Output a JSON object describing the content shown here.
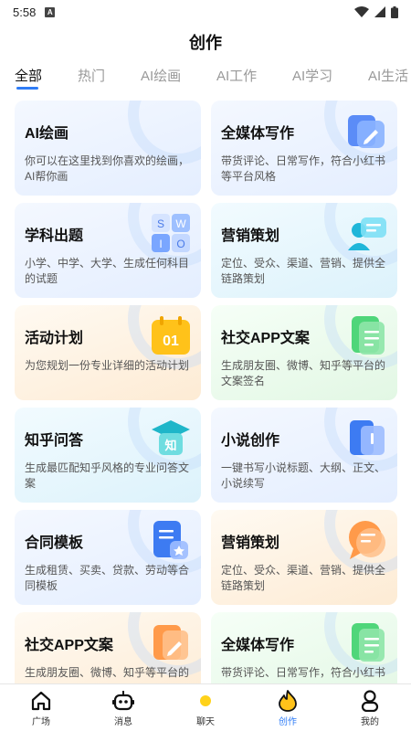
{
  "status_bar": {
    "time": "5:58",
    "app_icon": "A"
  },
  "header": {
    "title": "创作"
  },
  "tabs": [
    {
      "label": "全部",
      "active": true
    },
    {
      "label": "热门"
    },
    {
      "label": "AI绘画"
    },
    {
      "label": "AI工作"
    },
    {
      "label": "AI学习"
    },
    {
      "label": "AI生活"
    }
  ],
  "cards": [
    {
      "title": "AI绘画",
      "desc": "你可以在这里找到你喜欢的绘画，AI帮你画",
      "icon": "none"
    },
    {
      "title": "全媒体写作",
      "desc": "带货评论、日常写作，符合小红书等平台风格",
      "icon": "pencil-doc-icon"
    },
    {
      "title": "学科出题",
      "desc": "小学、中学、大学、生成任何科目的试题",
      "icon": "swio-blocks-icon",
      "icon_letters": [
        "S",
        "W",
        "I",
        "O"
      ]
    },
    {
      "title": "营销策划",
      "desc": "定位、受众、渠道、营销、提供全链路策划",
      "icon": "person-chat-icon"
    },
    {
      "title": "活动计划",
      "desc": "为您规划一份专业详细的活动计划",
      "icon": "calendar-icon",
      "icon_text": "01"
    },
    {
      "title": "社交APP文案",
      "desc": "生成朋友圈、微博、知乎等平台的文案签名",
      "icon": "green-doc-icon"
    },
    {
      "title": "知乎问答",
      "desc": "生成最匹配知乎风格的专业问答文案",
      "icon": "graduation-cap-icon",
      "icon_text": "知"
    },
    {
      "title": "小说创作",
      "desc": "一键书写小说标题、大纲、正文、小说续写",
      "icon": "book-icon"
    },
    {
      "title": "合同模板",
      "desc": "生成租赁、买卖、贷款、劳动等合同模板",
      "icon": "contract-icon"
    },
    {
      "title": "营销策划",
      "desc": "定位、受众、渠道、营销、提供全链路策划",
      "icon": "orange-chat-icon"
    },
    {
      "title": "社交APP文案",
      "desc": "生成朋友圈、微博、知乎等平台的",
      "icon": "orange-pencil-icon"
    },
    {
      "title": "全媒体写作",
      "desc": "带货评论、日常写作，符合小红书",
      "icon": "green-doc-icon"
    }
  ],
  "bottom_nav": [
    {
      "label": "广场",
      "icon": "home-icon"
    },
    {
      "label": "消息",
      "icon": "robot-icon"
    },
    {
      "label": "聊天",
      "icon": "sun-icon"
    },
    {
      "label": "创作",
      "icon": "flame-icon",
      "active": true
    },
    {
      "label": "我的",
      "icon": "person-icon"
    }
  ],
  "colors": {
    "accent": "#2f7cf6",
    "yellow": "#ffc21a",
    "green": "#4fd67a",
    "orange": "#ff9a4a"
  }
}
